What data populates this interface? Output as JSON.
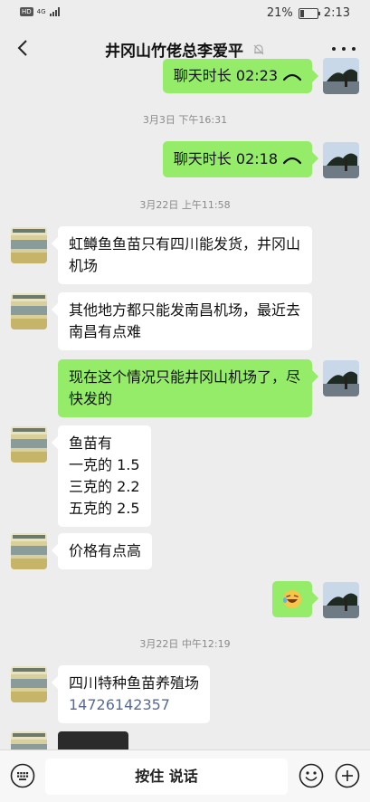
{
  "status": {
    "hd": "HD",
    "net": "4G",
    "battery": "21%",
    "battery_level": 0.21,
    "time": "2:13"
  },
  "header": {
    "title": "井冈山竹佬总李爱平"
  },
  "timestamps": [
    "3月3日 下午16:31",
    "3月22日 上午11:58",
    "3月22日 中午12:19"
  ],
  "messages": {
    "call1": "聊天时长 02:23",
    "call2": "聊天时长 02:18",
    "m1": "虹鳟鱼鱼苗只有四川能发货，井冈山机场",
    "m2": "其他地方都只能发南昌机场，最近去南昌有点难",
    "m3": "现在这个情况只能井冈山机场了，尽快发的",
    "m4_lines": [
      "鱼苗有",
      "一克的 1.5",
      "三克的 2.2",
      "五克的 2.5"
    ],
    "m5": "价格有点高",
    "m7_name": "四川特种鱼苗养殖场",
    "m7_phone": "14726142357"
  },
  "input": {
    "hold_to_talk": "按住 说话"
  },
  "icons": [
    "back-arrow-icon",
    "mute-bell-icon",
    "more-icon",
    "phone-hangup-icon",
    "emoji-icon",
    "keyboard-voice-icon",
    "plus-icon"
  ],
  "colors": {
    "background": "#ededed",
    "outgoing_bubble": "#95ec69",
    "incoming_bubble": "#ffffff",
    "link": "#576b95"
  }
}
